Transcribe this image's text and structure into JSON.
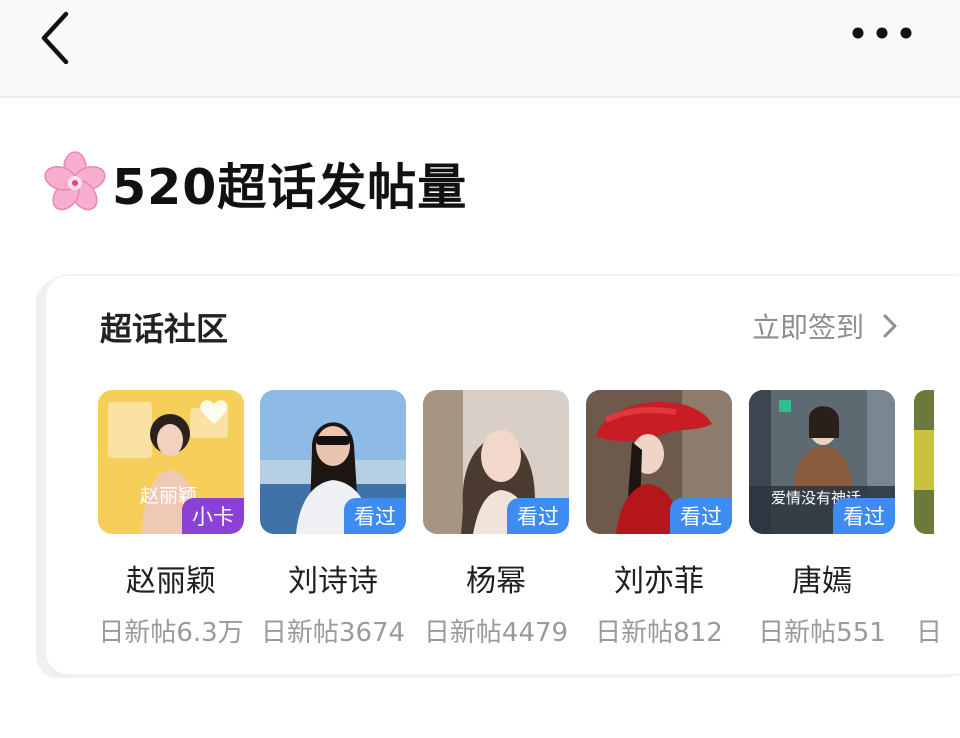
{
  "header": {
    "back_icon": "chevron-left-icon",
    "more_icon": "ellipsis-icon"
  },
  "post": {
    "emoji": "cherry-blossom-icon",
    "title": "520超话发帖量"
  },
  "card": {
    "title": "超话社区",
    "action_label": "立即签到",
    "items": [
      {
        "name": "赵丽颖",
        "stat": "日新帖6.3万",
        "badge": "小卡",
        "badge_color": "#8a41d8",
        "thumb_caption": "赵丽颖"
      },
      {
        "name": "刘诗诗",
        "stat": "日新帖3674",
        "badge": "看过",
        "badge_color": "#3e8cf2"
      },
      {
        "name": "杨幂",
        "stat": "日新帖4479",
        "badge": "看过",
        "badge_color": "#3e8cf2"
      },
      {
        "name": "刘亦菲",
        "stat": "日新帖812",
        "badge": "看过",
        "badge_color": "#3e8cf2"
      },
      {
        "name": "唐嫣",
        "stat": "日新帖551",
        "badge": "看过",
        "badge_color": "#3e8cf2",
        "thumb_caption": "爱情没有神话"
      }
    ],
    "partial_stat": "日"
  }
}
